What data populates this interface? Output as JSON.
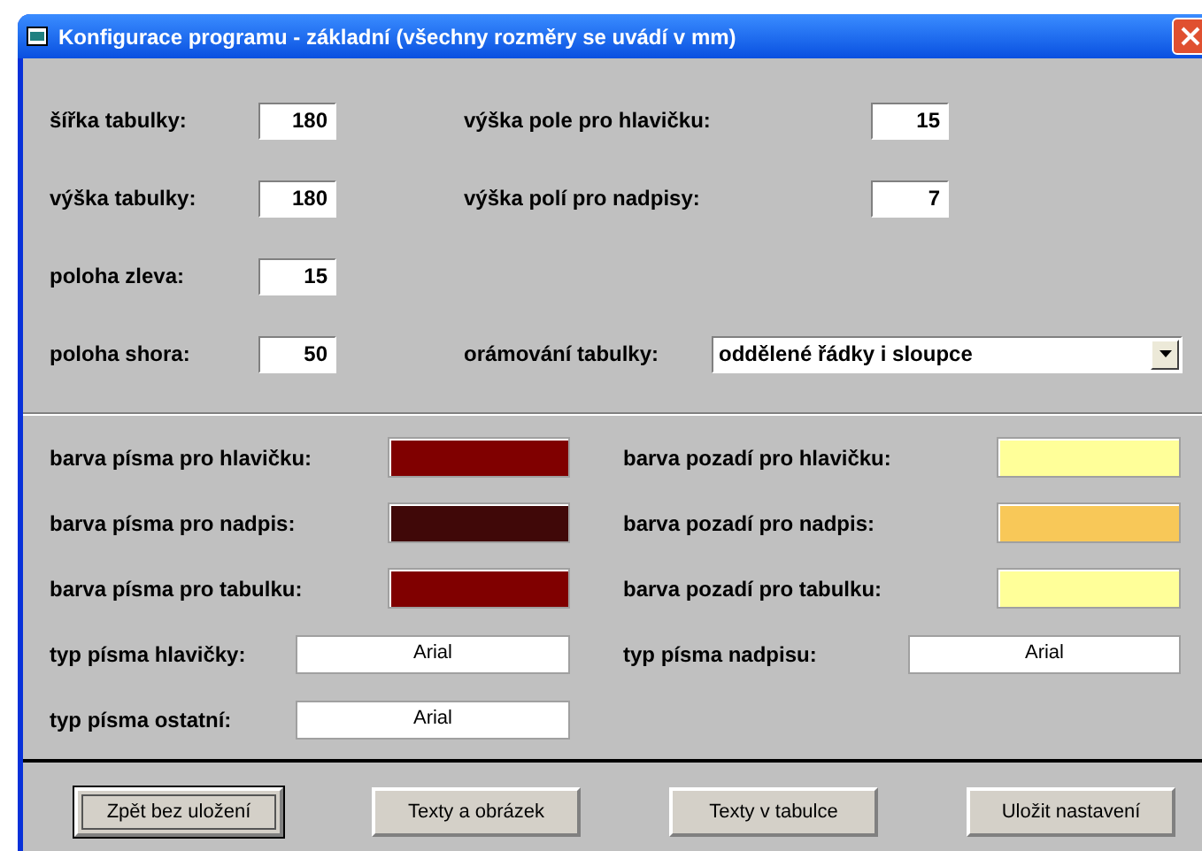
{
  "window": {
    "title": "Konfigurace programu - základní (všechny rozměry se uvádí v mm)"
  },
  "dimension_rows": [
    {
      "left": {
        "label": "šířka tabulky:",
        "value": "180"
      },
      "right": {
        "kind": "number",
        "label": "výška pole pro hlavičku:",
        "value": "15"
      }
    },
    {
      "left": {
        "label": "výška tabulky:",
        "value": "180"
      },
      "right": {
        "kind": "number",
        "label": "výška polí pro nadpisy:",
        "value": "7"
      }
    },
    {
      "left": {
        "label": "poloha zleva:",
        "value": "15"
      }
    },
    {
      "left": {
        "label": "poloha shora:",
        "value": "50"
      },
      "right": {
        "kind": "dropdown",
        "label": "orámování tabulky:",
        "value": "oddělené řádky i sloupce"
      }
    }
  ],
  "style_rows": [
    {
      "kind": "color",
      "left": {
        "label": "barva písma pro hlavičku:",
        "color": "#800000"
      },
      "right": {
        "label": "barva pozadí pro hlavičku:",
        "color": "#ffff99"
      }
    },
    {
      "kind": "color",
      "left": {
        "label": "barva písma pro nadpis:",
        "color": "#400808"
      },
      "right": {
        "label": "barva pozadí pro nadpis:",
        "color": "#f8c858"
      }
    },
    {
      "kind": "color",
      "left": {
        "label": "barva písma pro tabulku:",
        "color": "#800000"
      },
      "right": {
        "label": "barva pozadí pro tabulku:",
        "color": "#ffff99"
      }
    },
    {
      "kind": "font",
      "left": {
        "label": "typ písma hlavičky:",
        "value": "Arial"
      },
      "right": {
        "label": "typ písma nadpisu:",
        "value": "Arial"
      }
    },
    {
      "kind": "font",
      "left": {
        "label": "typ písma ostatní:",
        "value": "Arial"
      }
    }
  ],
  "buttons": [
    {
      "label": "Zpět bez uložení",
      "focused": true
    },
    {
      "label": "Texty a obrázek",
      "focused": false
    },
    {
      "label": "Texty v tabulce",
      "focused": false
    },
    {
      "label": "Uložit nastavení",
      "focused": false
    }
  ]
}
